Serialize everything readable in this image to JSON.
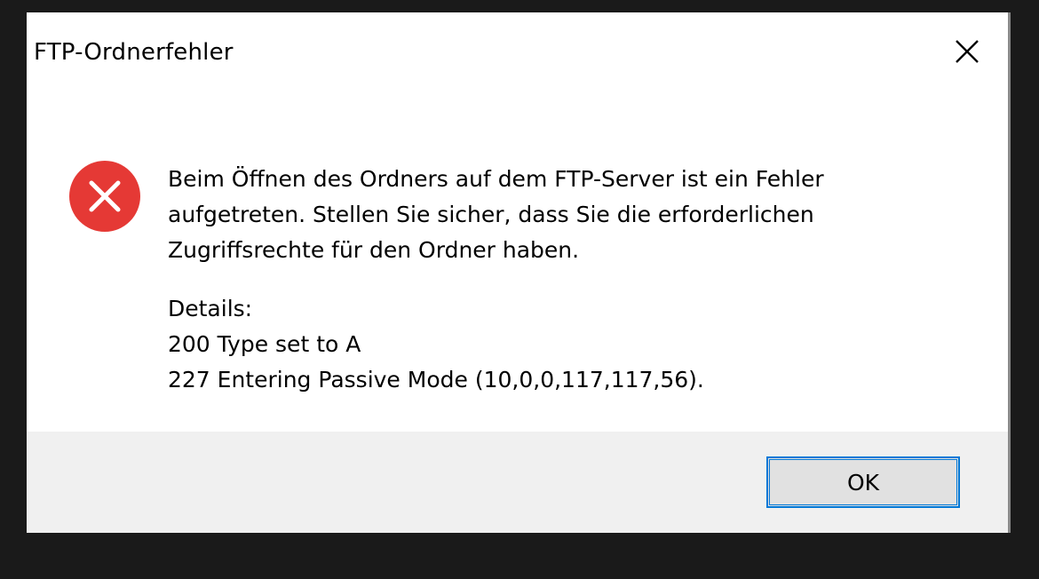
{
  "dialog": {
    "title": "FTP-Ordnerfehler",
    "close_icon": "close-icon",
    "status_icon": "error-icon",
    "status_color": "#e53935",
    "message": {
      "paragraph": [
        "Beim Öffnen des Ordners auf dem FTP-Server ist ein Fehler",
        "aufgetreten. Stellen Sie sicher, dass Sie die erforderlichen",
        "Zugriffsrechte für den Ordner haben."
      ],
      "details_label": "Details:",
      "details": [
        "200 Type set to A",
        "227 Entering Passive Mode (10,0,0,117,117,56)."
      ]
    },
    "ok_label": "OK",
    "accent_color": "#0078d7"
  }
}
